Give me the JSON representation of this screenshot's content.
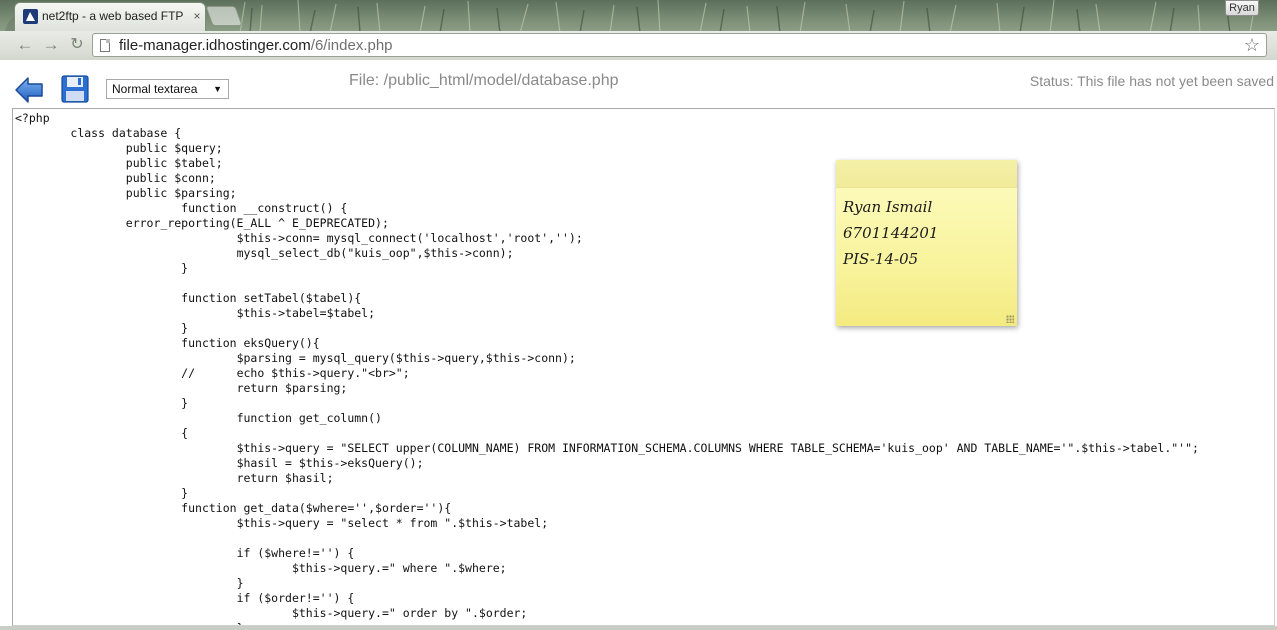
{
  "browser": {
    "tab_title": "net2ftp - a web based FTP",
    "tab_close": "×",
    "user_name": "Ryan",
    "url_host": "file-manager.idhostinger.com",
    "url_path": "/6/index.php"
  },
  "editor": {
    "mode_select": "Normal textarea",
    "file_label": "File: /public_html/model/database.php",
    "status_label": "Status: This file has not yet been saved",
    "code": "<?php\n\tclass database {\n\t\tpublic $query;\n\t\tpublic $tabel;\n\t\tpublic $conn;\n\t\tpublic $parsing;\n\t\t\tfunction __construct() {\n\t\terror_reporting(E_ALL ^ E_DEPRECATED);\n\t\t\t\t$this->conn= mysql_connect('localhost','root','');\n\t\t\t\tmysql_select_db(\"kuis_oop\",$this->conn);\n\t\t\t}\n\n\t\t\tfunction setTabel($tabel){\n\t\t\t\t$this->tabel=$tabel;\n\t\t\t}\n\t\t\tfunction eksQuery(){\n\t\t\t\t$parsing = mysql_query($this->query,$this->conn);\n\t\t\t//\techo $this->query.\"<br>\";\n\t\t\t\treturn $parsing;\n\t\t\t}\n\t\t\t\tfunction get_column()\n\t\t\t{\n\t\t\t\t$this->query = \"SELECT upper(COLUMN_NAME) FROM INFORMATION_SCHEMA.COLUMNS WHERE TABLE_SCHEMA='kuis_oop' AND TABLE_NAME='\".$this->tabel.\"'\";\n\t\t\t\t$hasil = $this->eksQuery();\n\t\t\t\treturn $hasil;\n\t\t\t}\n\t\t\tfunction get_data($where='',$order=''){\n\t\t\t\t$this->query = \"select * from \".$this->tabel;\n\n\t\t\t\tif ($where!='') {\n\t\t\t\t\t$this->query.=\" where \".$where;\n\t\t\t\t}\n\t\t\t\tif ($order!='') {\n\t\t\t\t\t$this->query.=\" order by \".$order;\n\t\t\t\t}"
  },
  "sticky_note": {
    "line1": "Ryan Ismail",
    "line2": "6701144201",
    "line3": "PIS-14-05"
  },
  "icons": {
    "back": "back-arrow-icon",
    "save": "floppy-disk-save-icon",
    "bookmark": "star-icon"
  }
}
